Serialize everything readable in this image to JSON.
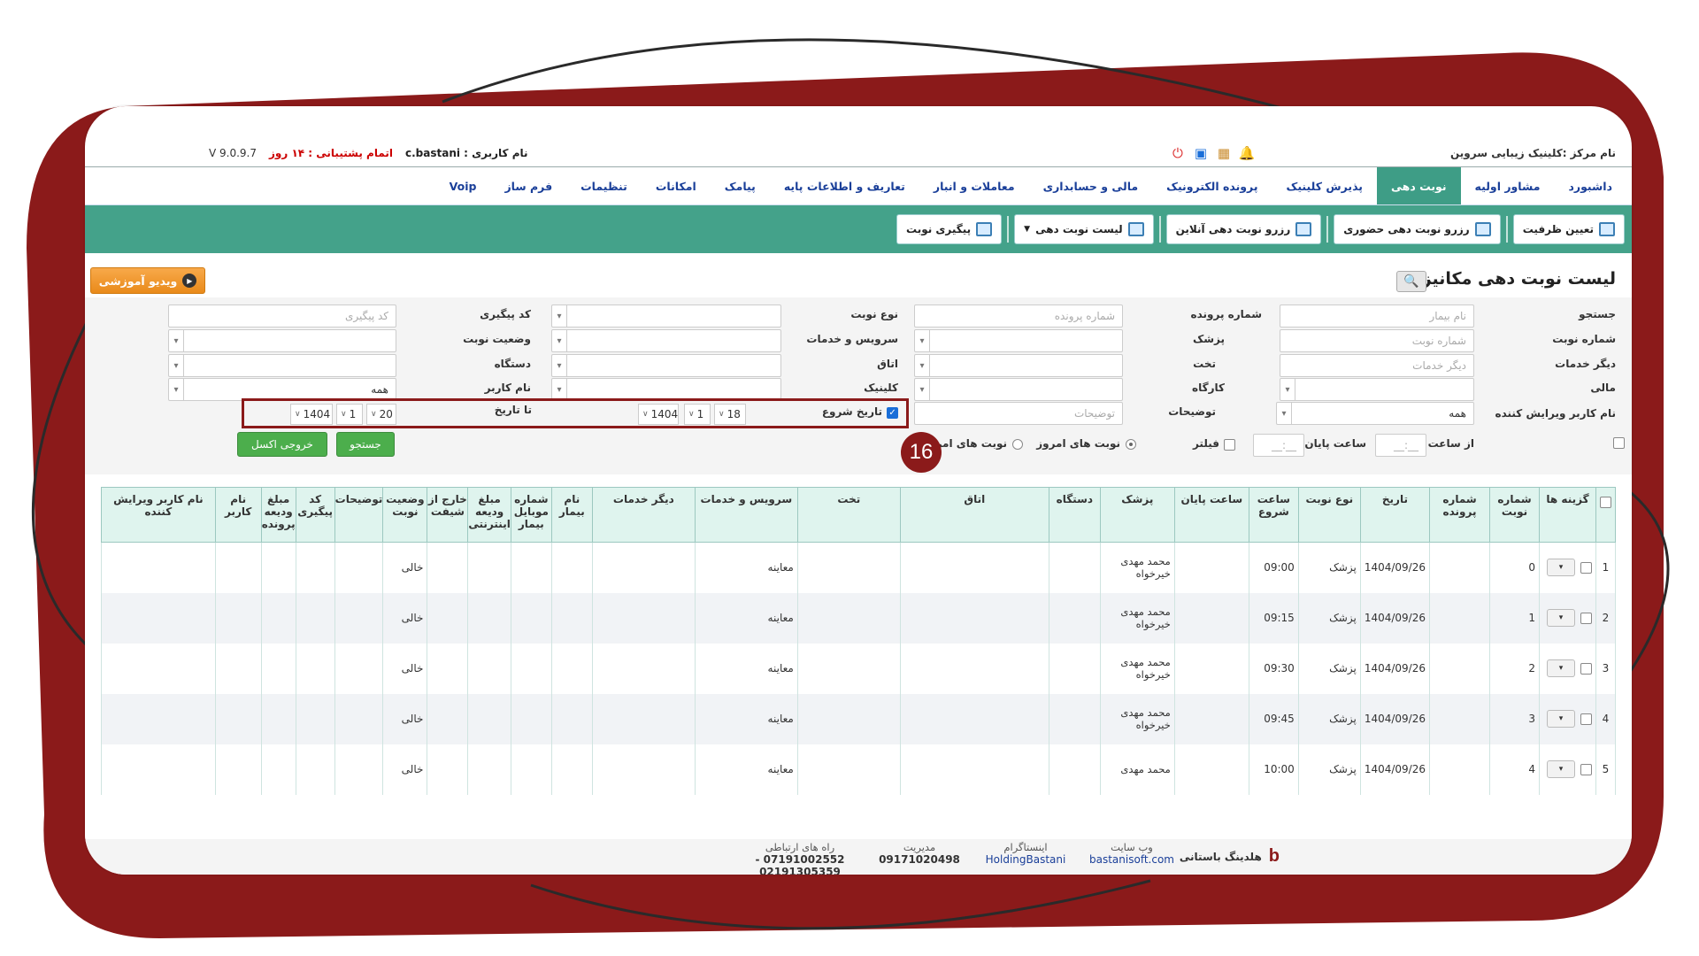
{
  "infobar": {
    "center_name": "نام مرکز :کلینیک زیبایی سروین",
    "username": "نام کاربری : c.bastani",
    "support": "اتمام پشتیبانی : ۱۴ روز",
    "version": "V 9.0.9.7"
  },
  "nav": [
    "داشبورد",
    "مشاور اولیه",
    "نوبت دهی",
    "پذیرش کلینیک",
    "پرونده الکترونیک",
    "مالی و حسابداری",
    "معاملات و انبار",
    "تعاریف و اطلاعات پایه",
    "پیامک",
    "امکانات",
    "تنظیمات",
    "فرم ساز",
    "Voip"
  ],
  "toolbar": [
    "تعیین ظرفیت",
    "رزرو نوبت دهی حضوری",
    "رزرو نوبت دهی آنلاین",
    "لیست نوبت دهی",
    "پیگیری نوبت"
  ],
  "page": {
    "title": "لیست نوبت دهی مکانیزه",
    "video_label": "ویدیو آموزشی"
  },
  "form": {
    "labels": {
      "search": "جستجو",
      "file_no": "شماره پرونده",
      "turn_type": "نوع نوبت",
      "tracking": "کد پیگیری",
      "turn_no": "شماره نوبت",
      "doctor": "پزشک",
      "service": "سرویس و خدمات",
      "turn_status": "وضعیت نوبت",
      "other_services": "دیگر خدمات",
      "bed": "تخت",
      "room": "اتاق",
      "device": "دستگاه",
      "financial": "مالی",
      "workshop": "کارگاه",
      "clinic": "کلینیک",
      "user": "نام کاربر",
      "editor": "نام کاربر ویرایش کننده",
      "notes": "توضیحات",
      "start_date": "تاریخ شروع",
      "to_date": "تا تاریخ",
      "from_time": "از ساعت",
      "end_time": "ساعت پایان",
      "filter": "فیلتر",
      "today_turns": "نوبت های امروز",
      "today_turns2": "نوبت های امروز"
    },
    "placeholders": {
      "patient_name": "نام بیمار",
      "turn_no": "شماره نوبت",
      "other_services": "دیگر خدمات",
      "file_no": "شماره پرونده",
      "notes": "توضیحات",
      "tracking": "کد پیگیری",
      "time": "__:__"
    },
    "values": {
      "editor": "همه",
      "user": "همه",
      "start_day": "18",
      "start_month": "1",
      "start_year": "1404",
      "end_day": "20",
      "end_month": "1",
      "end_year": "1404"
    },
    "buttons": {
      "search": "جستجو",
      "excel": "خروجی اکسل"
    },
    "callout": "16"
  },
  "grid": {
    "headers": [
      "گزینه ها",
      "شماره نوبت",
      "شماره پرونده",
      "تاریخ",
      "نوع نوبت",
      "ساعت شروع",
      "ساعت پایان",
      "پزشک",
      "دستگاه",
      "اتاق",
      "تخت",
      "سرویس و خدمات",
      "دیگر خدمات",
      "نام بیمار",
      "شماره موبایل بیمار",
      "مبلغ ودیعه اینترنتی",
      "خارج از شیفت",
      "وضعیت نوبت",
      "توضیحات",
      "کد پیگیری",
      "مبلغ ودیعه پرونده",
      "نام کاربر",
      "نام کاربر ویرایش کننده"
    ],
    "rows": [
      {
        "idx": "1",
        "turn": "0",
        "date": "1404/09/26",
        "type": "پزشک",
        "start": "09:00",
        "doctor": "محمد مهدی خیرخواه",
        "service": "معاینه",
        "status": "خالی"
      },
      {
        "idx": "2",
        "turn": "1",
        "date": "1404/09/26",
        "type": "پزشک",
        "start": "09:15",
        "doctor": "محمد مهدی خیرخواه",
        "service": "معاینه",
        "status": "خالی"
      },
      {
        "idx": "3",
        "turn": "2",
        "date": "1404/09/26",
        "type": "پزشک",
        "start": "09:30",
        "doctor": "محمد مهدی خیرخواه",
        "service": "معاینه",
        "status": "خالی"
      },
      {
        "idx": "4",
        "turn": "3",
        "date": "1404/09/26",
        "type": "پزشک",
        "start": "09:45",
        "doctor": "محمد مهدی خیرخواه",
        "service": "معاینه",
        "status": "خالی"
      },
      {
        "idx": "5",
        "turn": "4",
        "date": "1404/09/26",
        "type": "پزشک",
        "start": "10:00",
        "doctor": "محمد مهدی",
        "service": "معاینه",
        "status": "خالی"
      }
    ]
  },
  "footer": {
    "brand": "هلدینگ باستانی",
    "website_cap": "وب سایت",
    "website": "bastanisoft.com",
    "instagram_cap": "اینستاگرام",
    "instagram": "HoldingBastani",
    "manager_cap": "مدیریت",
    "manager": "09171020498",
    "contact_cap": "راه های ارتباطی",
    "contact": "07191002552 - 02191305359"
  },
  "colors": {
    "accent": "#44a28a",
    "frame": "#8b1a1a",
    "nav_link": "#1a3f99",
    "button_orange": "#f0962a",
    "button_green": "#4cae4c"
  }
}
